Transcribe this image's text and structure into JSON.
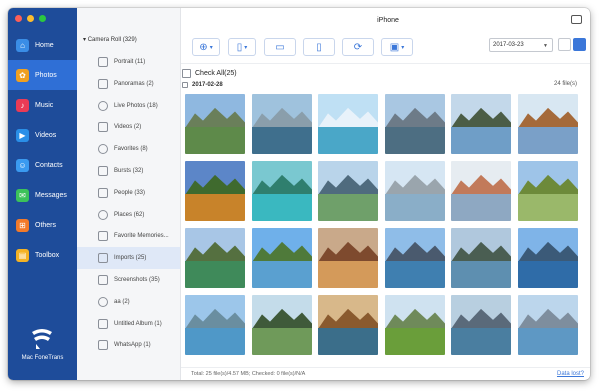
{
  "window": {
    "title": "iPhone"
  },
  "nav": {
    "items": [
      {
        "label": "Home",
        "icon": "home-icon",
        "color": "#3a8de6",
        "active": false
      },
      {
        "label": "Photos",
        "icon": "photos-icon",
        "color": "#f0a020",
        "active": true
      },
      {
        "label": "Music",
        "icon": "music-icon",
        "color": "#ea3b56",
        "active": false
      },
      {
        "label": "Videos",
        "icon": "videos-icon",
        "color": "#2a8fe8",
        "active": false
      },
      {
        "label": "Contacts",
        "icon": "contacts-icon",
        "color": "#3a9af0",
        "active": false
      },
      {
        "label": "Messages",
        "icon": "messages-icon",
        "color": "#3cc25a",
        "active": false
      },
      {
        "label": "Others",
        "icon": "others-icon",
        "color": "#f27a2a",
        "active": false
      },
      {
        "label": "Toolbox",
        "icon": "toolbox-icon",
        "color": "#f4b224",
        "active": false
      }
    ],
    "brand": "Mac FoneTrans"
  },
  "albums": {
    "header": "Camera Roll (329)",
    "items": [
      {
        "label": "Portrait (11)",
        "active": false
      },
      {
        "label": "Panoramas (2)",
        "active": false
      },
      {
        "label": "Live Photos (18)",
        "active": false
      },
      {
        "label": "Videos (2)",
        "active": false
      },
      {
        "label": "Favorites (8)",
        "active": false
      },
      {
        "label": "Bursts (32)",
        "active": false
      },
      {
        "label": "People (33)",
        "active": false
      },
      {
        "label": "Places (62)",
        "active": false
      },
      {
        "label": "Favorite Memories...",
        "active": false
      },
      {
        "label": "Imports (25)",
        "active": true
      },
      {
        "label": "Screenshots (35)",
        "active": false
      },
      {
        "label": "aa (2)",
        "active": false
      },
      {
        "label": "Untitled Album (1)",
        "active": false
      },
      {
        "label": "WhatsApp (1)",
        "active": false
      }
    ]
  },
  "toolbar": {
    "date_value": "2017-03-23",
    "buttons": [
      "add-icon",
      "export-device-icon",
      "export-pc-icon",
      "delete-icon",
      "convert-icon",
      "toolbox-icon"
    ]
  },
  "content": {
    "check_all": "Check All(25)",
    "date_header": "2017-02-28",
    "file_count": "24 file(s)"
  },
  "photos": [
    [
      "#8fb8e0",
      "#6a7f5a",
      "#5e8a4a"
    ],
    [
      "#9fc2dd",
      "#8a9eab",
      "#3f6f8d"
    ],
    [
      "#bfe0f4",
      "#e8f2fa",
      "#4aa7c8"
    ],
    [
      "#a9c7e2",
      "#6d7b88",
      "#4d6e82"
    ],
    [
      "#c3d8ea",
      "#4b5d46",
      "#6f9ec7"
    ],
    [
      "#d8e7f2",
      "#a56a3a",
      "#7aa0c8"
    ],
    [
      "#5c86c8",
      "#3f6a2e",
      "#c8832a"
    ],
    [
      "#7ac8d0",
      "#2f7f6e",
      "#3ab8c0"
    ],
    [
      "#b9d4ea",
      "#4f6b7e",
      "#6fa06a"
    ],
    [
      "#d6e6f3",
      "#9aa5ad",
      "#8aaec8"
    ],
    [
      "#e6ecf1",
      "#c27a5a",
      "#8ea8c2"
    ],
    [
      "#9ec4e8",
      "#6d8a3a",
      "#9ab86a"
    ],
    [
      "#a8c6e6",
      "#557040",
      "#3f8a5a"
    ],
    [
      "#6fb0ea",
      "#4f7a3a",
      "#5aa0d0"
    ],
    [
      "#c9a98a",
      "#7e4a2e",
      "#d49a5a"
    ],
    [
      "#8fbde8",
      "#4a5a6e",
      "#3f7fb0"
    ],
    [
      "#b0c8dd",
      "#4a5e52",
      "#5e8fb0"
    ],
    [
      "#7fb4e8",
      "#3b5a78",
      "#2f6ca8"
    ],
    [
      "#9cc6ea",
      "#6a8ea0",
      "#4f98c8"
    ],
    [
      "#c4dcea",
      "#3f5a3a",
      "#6f9a5a"
    ],
    [
      "#d8b88a",
      "#8a5a2e",
      "#3b6e8a"
    ],
    [
      "#cfe2f0",
      "#6f8a5a",
      "#6a9e3a"
    ],
    [
      "#b8cfe0",
      "#5a6a7a",
      "#4a7ea0"
    ],
    [
      "#bcd6ec",
      "#7e8e9e",
      "#5e98c4"
    ]
  ],
  "footer": {
    "status": "Total: 25 file(s)/4.57 MB; Checked: 0 file(s)/N/A",
    "link": "Data lost?"
  }
}
